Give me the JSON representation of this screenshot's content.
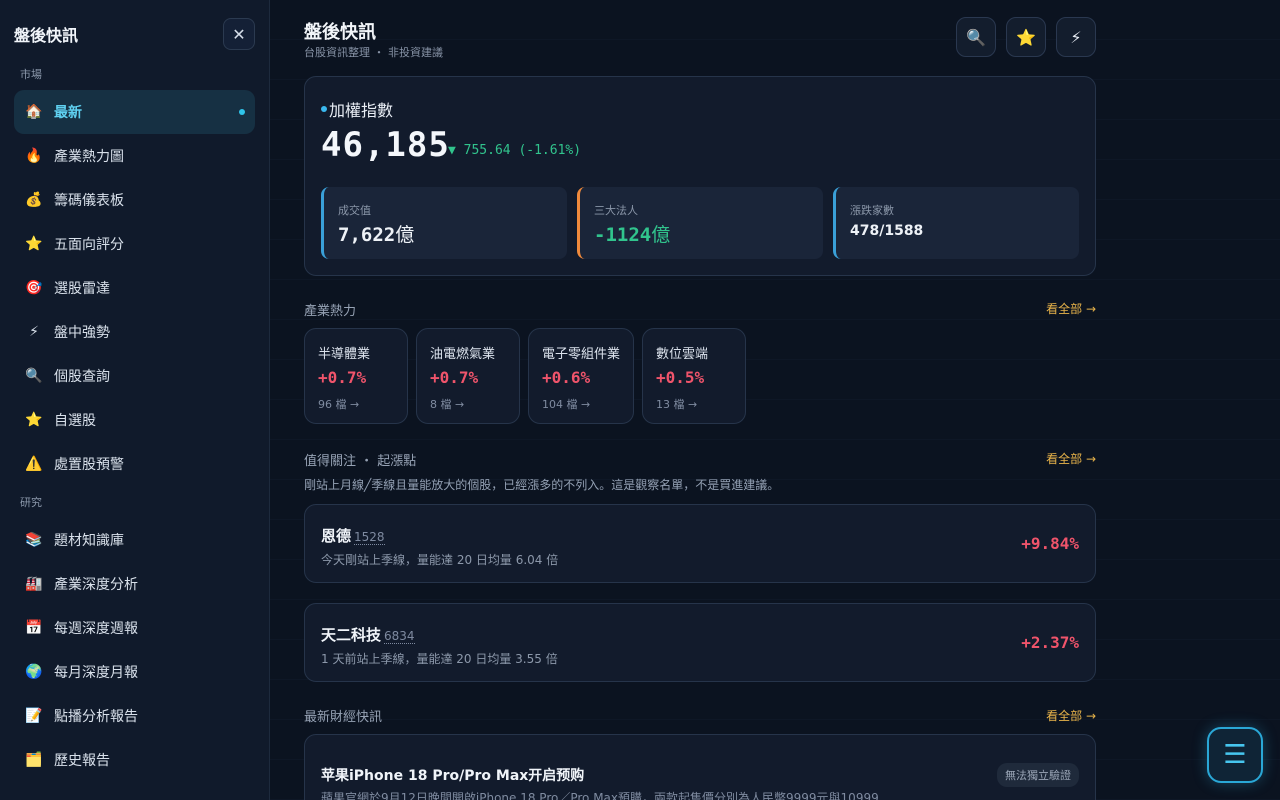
{
  "sidebar": {
    "title": "盤後快訊",
    "close_icon": "close-icon",
    "sections": [
      {
        "label": "市場",
        "items": [
          {
            "icon": "🏠",
            "label": "最新",
            "active": true
          },
          {
            "icon": "🔥",
            "label": "產業熱力圖"
          },
          {
            "icon": "💰",
            "label": "籌碼儀表板"
          },
          {
            "icon": "⭐",
            "label": "五面向評分"
          },
          {
            "icon": "🎯",
            "label": "選股雷達"
          },
          {
            "icon": "⚡",
            "label": "盤中強勢"
          },
          {
            "icon": "🔍",
            "label": "個股查詢"
          },
          {
            "icon": "⭐",
            "label": "自選股"
          },
          {
            "icon": "⚠️",
            "label": "處置股預警"
          }
        ]
      },
      {
        "label": "研究",
        "items": [
          {
            "icon": "📚",
            "label": "題材知識庫"
          },
          {
            "icon": "🏭",
            "label": "產業深度分析"
          },
          {
            "icon": "📅",
            "label": "每週深度週報"
          },
          {
            "icon": "🌍",
            "label": "每月深度月報"
          },
          {
            "icon": "📝",
            "label": "點播分析報告"
          },
          {
            "icon": "🗂️",
            "label": "歷史報告"
          }
        ]
      }
    ]
  },
  "header": {
    "title": "盤後快訊",
    "subtitle": "台股資訊整理 ・ 非投資建議",
    "buttons": [
      {
        "icon": "🔍",
        "name": "search-button"
      },
      {
        "icon": "⭐",
        "name": "favorite-button"
      },
      {
        "icon": "⚡",
        "name": "flash-button"
      }
    ]
  },
  "index": {
    "name": "加權指數",
    "value": "46,185",
    "change": "▼ 755.64 (-1.61%)",
    "stats": [
      {
        "label": "成交值",
        "value": "7,622",
        "unit": "億",
        "color": "#3aa0d8"
      },
      {
        "label": "三大法人",
        "value": "-1124",
        "unit": "億",
        "color": "#f08a3c",
        "value_color": "#31c48d"
      },
      {
        "label": "漲跌家數",
        "value": "478/1588",
        "unit": "",
        "color": "#3aa0d8"
      }
    ]
  },
  "industry": {
    "label": "產業熱力",
    "see_all": "看全部 →",
    "items": [
      {
        "name": "半導體業",
        "pct": "+0.7%",
        "count": "96 檔 →"
      },
      {
        "name": "油電燃氣業",
        "pct": "+0.7%",
        "count": "8 檔 →"
      },
      {
        "name": "電子零組件業",
        "pct": "+0.6%",
        "count": "104 檔 →"
      },
      {
        "name": "數位雲端",
        "pct": "+0.5%",
        "count": "13 檔 →"
      }
    ]
  },
  "watch": {
    "label": "值得關注 ・ 起漲點",
    "see_all": "看全部 →",
    "description": "剛站上月線╱季線且量能放大的個股，已經漲多的不列入。這是觀察名單，不是買進建議。",
    "stocks": [
      {
        "name": "恩德",
        "code": "1528",
        "note": "今天剛站上季線，量能達 20 日均量 6.04 倍",
        "pct": "+9.84%"
      },
      {
        "name": "天二科技",
        "code": "6834",
        "note": "1 天前站上季線，量能達 20 日均量 3.55 倍",
        "pct": "+2.37%"
      }
    ]
  },
  "news": {
    "label": "最新財經快訊",
    "see_all": "看全部 →",
    "items": [
      {
        "title": "苹果iPhone 18 Pro/Pro Max开启预购",
        "body": "蘋果官網於9月12日晚間開啟iPhone 18 Pro／Pro Max預購，兩款起售價分別為人民幣9999元與10999…",
        "badge": "無法獨立驗證"
      }
    ]
  },
  "fab": {
    "icon": "☰"
  },
  "colors": {
    "accent": "#2fc4ea",
    "up": "#f0546b",
    "down": "#31c48d",
    "link": "#e7b34a"
  }
}
